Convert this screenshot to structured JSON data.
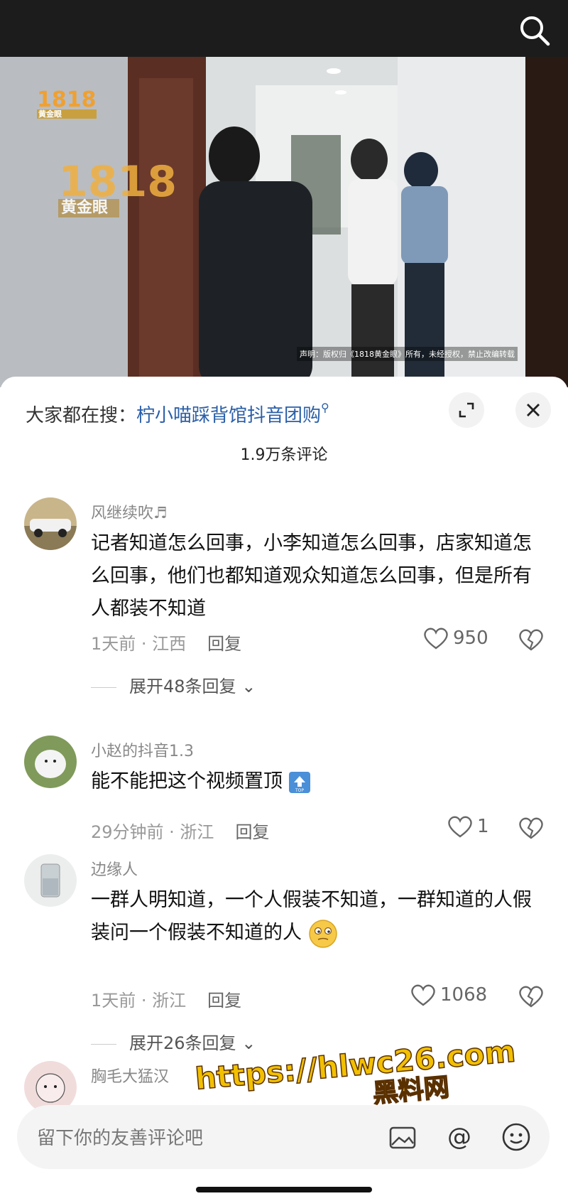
{
  "video": {
    "watermark_small": "1818",
    "watermark_small_sub": "黄金眼",
    "watermark_big": "1818",
    "watermark_big_sub": "黄金眼",
    "disclaimer": "声明：版权归《1818黄金眼》所有，未经授权，禁止改编转载"
  },
  "trending": {
    "prefix": "大家都在搜：",
    "query": "柠小喵踩背馆抖音团购"
  },
  "comment_count": "1.9万条评论",
  "comments": [
    {
      "username": "风继续吹♬",
      "text": "记者知道怎么回事，小李知道怎么回事，店家知道怎么回事，他们也都知道观众知道怎么回事，但是所有人都装不知道",
      "time_location": "1天前 · 江西",
      "reply": "回复",
      "likes": "950",
      "expand": "展开48条回复"
    },
    {
      "username": "小赵的抖音1.3",
      "text": "能不能把这个视频置顶",
      "time_location": "29分钟前 · 浙江",
      "reply": "回复",
      "likes": "1"
    },
    {
      "username": "边缘人",
      "text": "一群人明知道，一个人假装不知道，一群知道的人假装问一个假装不知道的人",
      "time_location": "1天前 · 浙江",
      "reply": "回复",
      "likes": "1068",
      "expand": "展开26条回复"
    },
    {
      "username": "胸毛大猛汉"
    }
  ],
  "input": {
    "placeholder": "留下你的友善评论吧"
  },
  "site_watermark": {
    "line1": "https://hlwc26.com",
    "line2": "黑料网"
  },
  "icons": [
    "search-icon",
    "expand-icon",
    "close-icon",
    "heart-icon",
    "broken-heart-icon",
    "top-icon",
    "emoji-icon",
    "image-icon",
    "at-icon",
    "smile-icon"
  ]
}
